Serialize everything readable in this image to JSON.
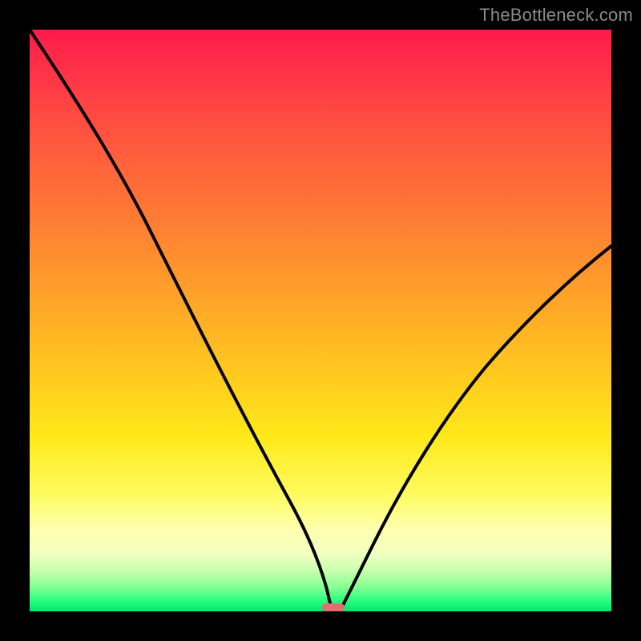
{
  "watermark": "TheBottleneck.com",
  "chart_data": {
    "type": "line",
    "title": "",
    "xlabel": "",
    "ylabel": "",
    "xlim": [
      0,
      100
    ],
    "ylim": [
      0,
      100
    ],
    "grid": false,
    "legend": false,
    "series": [
      {
        "name": "bottleneck-curve",
        "x": [
          0,
          5,
          10,
          15,
          20,
          25,
          30,
          35,
          40,
          45,
          48,
          50,
          51,
          52,
          53,
          55,
          60,
          65,
          70,
          75,
          80,
          85,
          90,
          95,
          100
        ],
        "values": [
          100,
          90,
          80,
          70,
          60,
          51,
          42,
          33,
          24,
          15,
          8,
          3,
          1,
          0,
          1,
          3,
          10,
          18,
          26,
          34,
          41,
          48,
          54,
          60,
          65
        ]
      }
    ],
    "marker": {
      "x": 52,
      "y": 0,
      "color": "#e07070"
    },
    "background_gradient": {
      "top": "#ff1a4b",
      "mid": "#ffe91a",
      "bottom": "#00e870"
    }
  }
}
